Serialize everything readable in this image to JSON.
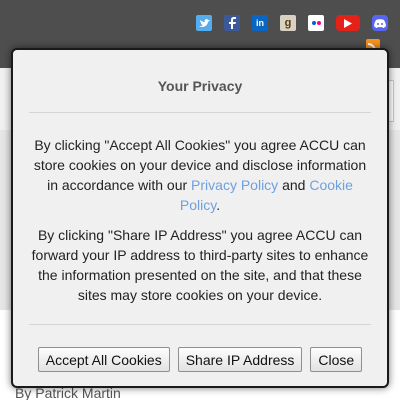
{
  "header": {
    "social_icons": [
      "twitter-icon",
      "facebook-icon",
      "linkedin-icon",
      "goodreads-icon",
      "flickr-icon",
      "youtube-icon",
      "discord-icon"
    ],
    "linkedin_glyph": "in",
    "goodreads_glyph": "g",
    "rss_icon": "rss-icon",
    "bar_color": "#4e4e4e"
  },
  "article": {
    "author": "By Patrick Martin"
  },
  "privacy_dialog": {
    "title": "Your Privacy",
    "cookies_text_before": "By clicking \"Accept All Cookies\" you agree ACCU can store cookies on your device and disclose information in accordance with our ",
    "privacy_policy_link": "Privacy Policy",
    "and_text": " and ",
    "cookie_policy_link": "Cookie Policy",
    "period": ".",
    "share_ip_text": "By clicking \"Share IP Address\" you agree ACCU can forward your IP address to third-party sites to enhance the information presented on the site, and that these sites may store cookies on your device.",
    "buttons": {
      "accept_all": "Accept All Cookies",
      "share_ip": "Share IP Address",
      "close": "Close"
    },
    "link_color": "#6ea0df"
  }
}
